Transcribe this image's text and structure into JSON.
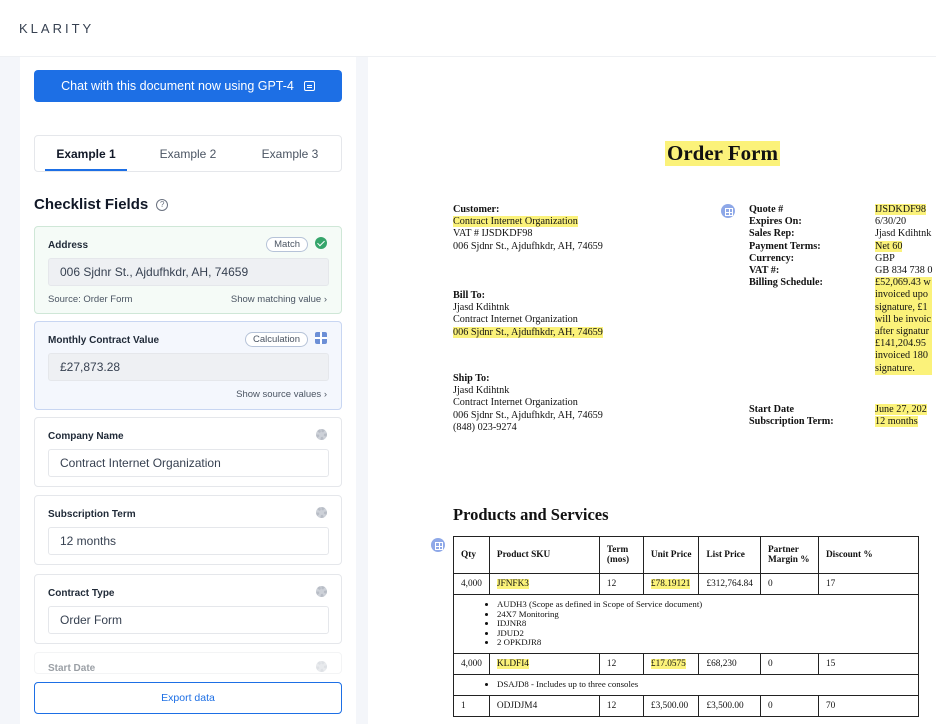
{
  "app": {
    "logo": "KLARITY"
  },
  "sidebar": {
    "chat_button_label": "Chat with this document now using GPT-4",
    "tabs": [
      {
        "label": "Example 1",
        "active": true
      },
      {
        "label": "Example 2",
        "active": false
      },
      {
        "label": "Example 3",
        "active": false
      }
    ],
    "checklist_title": "Checklist Fields",
    "fields": {
      "address": {
        "label": "Address",
        "badge": "Match",
        "value": "006 Sjdnr St., Ajdufhkdr, AH, 74659",
        "source": "Source: Order Form",
        "action": "Show matching value"
      },
      "monthly": {
        "label": "Monthly Contract Value",
        "badge": "Calculation",
        "value": "£27,873.28",
        "action": "Show source values"
      },
      "company": {
        "label": "Company Name",
        "value": "Contract Internet Organization"
      },
      "term": {
        "label": "Subscription Term",
        "value": "12 months"
      },
      "type": {
        "label": "Contract Type",
        "value": "Order Form"
      },
      "start": {
        "label": "Start Date"
      }
    },
    "export_label": "Export data"
  },
  "document": {
    "title": "Order Form",
    "customer": {
      "heading": "Customer:",
      "name": "Contract Internet Organization",
      "vat": "VAT # IJSDKDF98",
      "address": "006 Sjdnr St., Ajdufhkdr, AH, 74659"
    },
    "bill_to": {
      "heading": "Bill To:",
      "person": "Jjasd Kdihtnk",
      "org": "Contract Internet Organization",
      "address": "006 Sjdnr St., Ajdufhkdr, AH, 74659"
    },
    "ship_to": {
      "heading": "Ship To:",
      "person": "Jjasd Kdihtnk",
      "org": "Contract Internet Organization",
      "address": "006 Sjdnr St., Ajdufhkdr, AH, 74659",
      "phone": "(848) 023-9274"
    },
    "quote": {
      "labels": {
        "quote": "Quote #",
        "expires": "Expires On:",
        "sales": "Sales Rep:",
        "payment": "Payment Terms:",
        "currency": "Currency:",
        "vat": "VAT #:",
        "billing": "Billing Schedule:",
        "start": "Start Date",
        "sub": "Subscription Term:"
      },
      "values": {
        "quote": "IJSDKDF98",
        "expires": "6/30/20",
        "sales": "Jjasd Kdihtnk",
        "payment": "Net 60",
        "currency": "GBP",
        "vat": "GB 834 738 0",
        "billing_lines": [
          "£52,069.43 w",
          "invoiced upo",
          "signature, £1",
          "will be invoic",
          "after signatur",
          "£141,204.95",
          "invoiced 180",
          "signature."
        ],
        "start": "June 27, 202",
        "sub": "12 months"
      }
    },
    "products_title": "Products and Services",
    "table": {
      "headers": [
        "Qty",
        "Product SKU",
        "Term (mos)",
        "Unit Price",
        "List Price",
        "Partner Margin %",
        "Discount %"
      ],
      "rows": [
        {
          "qty": "4,000",
          "sku": "JFNFK3",
          "term": "12",
          "unit": "£78.19121",
          "list": "£312,764.84",
          "margin": "0",
          "discount": "17",
          "bullets": [
            "AUDH3 (Scope as defined in Scope of Service document)",
            "24X7 Monitoring",
            "IDJNR8",
            "JDUD2",
            "2 OPKDJR8"
          ]
        },
        {
          "qty": "4,000",
          "sku": "KLDFI4",
          "term": "12",
          "unit": "£17.0575",
          "list": "£68,230",
          "margin": "0",
          "discount": "15",
          "bullets": [
            "DSAJD8 - Includes up to three consoles"
          ]
        },
        {
          "qty": "1",
          "sku": "ODJDJM4",
          "term": "12",
          "unit": "£3,500.00",
          "list": "£3,500.00",
          "margin": "0",
          "discount": "70"
        }
      ]
    }
  }
}
